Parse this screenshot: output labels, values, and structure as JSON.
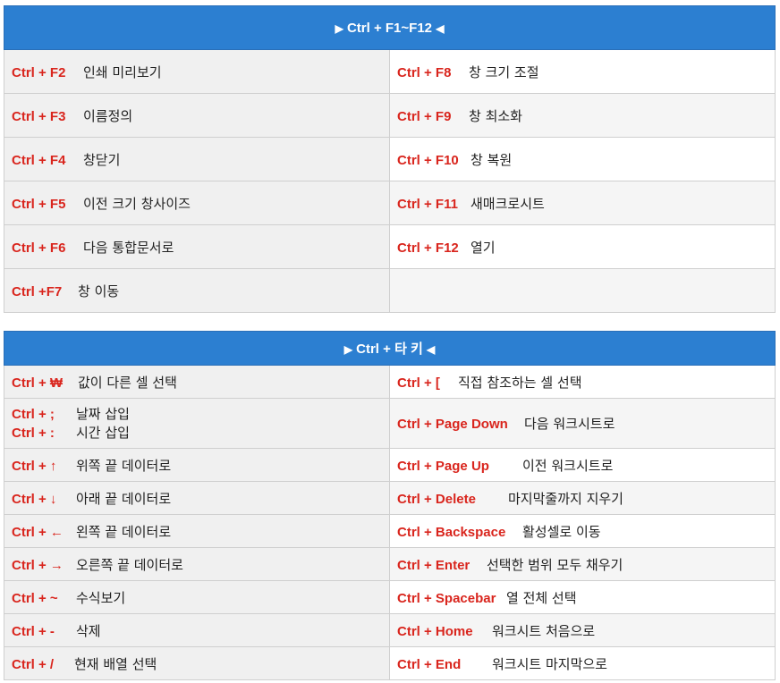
{
  "table1": {
    "header": {
      "left_glyph": "▶",
      "title": "Ctrl + F1~F12",
      "right_glyph": "◀"
    },
    "rows": [
      {
        "left_key": "Ctrl + F2",
        "left_desc": "인쇄 미리보기",
        "right_key": "Ctrl + F8",
        "right_desc": "창 크기 조절"
      },
      {
        "left_key": "Ctrl + F3",
        "left_desc": "이름정의",
        "right_key": "Ctrl + F9",
        "right_desc": "창 최소화"
      },
      {
        "left_key": "Ctrl + F4",
        "left_desc": "창닫기",
        "right_key": "Ctrl + F10",
        "right_desc": "창 복원"
      },
      {
        "left_key": "Ctrl + F5",
        "left_desc": "이전 크기 창사이즈",
        "right_key": "Ctrl + F11",
        "right_desc": "새매크로시트"
      },
      {
        "left_key": "Ctrl + F6",
        "left_desc": "다음 통합문서로",
        "right_key": "Ctrl + F12",
        "right_desc": "열기"
      },
      {
        "left_key": "Ctrl +F7",
        "left_desc": "창 이동",
        "right_key": "",
        "right_desc": ""
      }
    ]
  },
  "table2": {
    "header": {
      "left_glyph": "▶",
      "title": "Ctrl + 타 키",
      "right_glyph": "◀"
    },
    "rows": [
      {
        "left_key": "Ctrl + ₩",
        "left_desc": "값이 다른 셀 선택",
        "right_key": "Ctrl + [",
        "right_desc": "직접 참조하는 셀 선택"
      },
      {
        "left_key": "Ctrl + ;",
        "left_desc": "날짜 삽입",
        "left_key2": "Ctrl + :",
        "left_desc2": "시간 삽입",
        "right_key": "Ctrl + Page Down",
        "right_desc": "다음 워크시트로"
      },
      {
        "left_key": "Ctrl + ↑",
        "left_desc": "위쪽 끝 데이터로",
        "right_key": "Ctrl + Page Up",
        "right_desc": "이전 워크시트로"
      },
      {
        "left_key": "Ctrl + ↓",
        "left_desc": "아래 끝 데이터로",
        "right_key": "Ctrl + Delete",
        "right_desc": "마지막줄까지 지우기"
      },
      {
        "left_key": "Ctrl + ←",
        "left_desc": "왼쪽 끝 데이터로",
        "right_key": "Ctrl + Backspace",
        "right_desc": "활성셀로 이동"
      },
      {
        "left_key": "Ctrl + →",
        "left_desc": "오른쪽 끝 데이터로",
        "right_key": "Ctrl + Enter",
        "right_desc": "선택한 범위 모두 채우기"
      },
      {
        "left_key": "Ctrl + ~",
        "left_desc": "수식보기",
        "right_key": "Ctrl + Spacebar",
        "right_desc": "열 전체 선택"
      },
      {
        "left_key": "Ctrl + -",
        "left_desc": "삭제",
        "right_key": "Ctrl + Home",
        "right_desc": "워크시트 처음으로"
      },
      {
        "left_key": "Ctrl + /",
        "left_desc": "현재 배열 선택",
        "right_key": "Ctrl + End",
        "right_desc": "워크시트 마지막으로"
      }
    ]
  }
}
